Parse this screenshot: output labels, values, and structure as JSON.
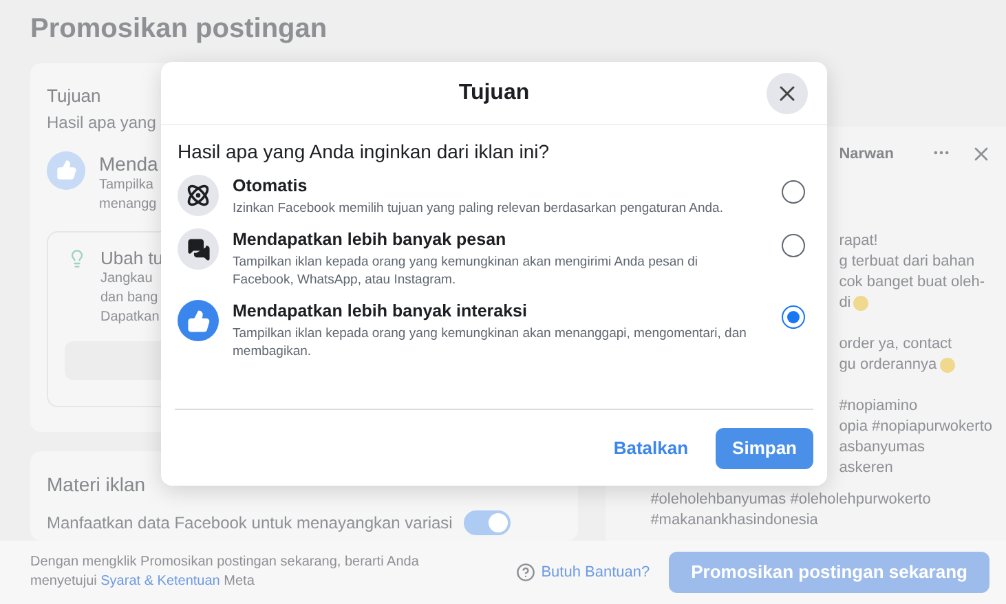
{
  "page": {
    "title": "Promosikan postingan"
  },
  "objective_card": {
    "title": "Tujuan",
    "subtitle": "Hasil apa yang",
    "selected_objective": {
      "title": "Menda",
      "lines": [
        "Tampilka",
        "menangg"
      ]
    },
    "tip": {
      "title": "Ubah tu",
      "lines": [
        "Jangkau",
        "dan bang",
        "Dapatkan"
      ]
    }
  },
  "creative_card": {
    "title": "Materi iklan",
    "description": "Manfaatkan data Facebook untuk menayangkan variasi",
    "toggle": {
      "on": true
    }
  },
  "preview": {
    "author": "Narwan",
    "paragraphs": [
      [
        {
          "text": "rapat!"
        },
        {
          "text": "g terbuat dari bahan"
        },
        {
          "text": "cok banget buat oleh-"
        },
        {
          "text": "di",
          "emoji": true
        }
      ],
      [
        {
          "text": "order ya, contact"
        },
        {
          "text": "gu orderannya",
          "emoji": true
        }
      ],
      [
        {
          "text": "#nopiamino"
        },
        {
          "text": "opia #nopiapurwokerto"
        },
        {
          "text": "asbanyumas"
        },
        {
          "text": "askeren"
        }
      ]
    ],
    "hashtag_lines": [
      "#oleholehbanyumas #oleholehpurwokerto",
      "#makanankhasindonesia"
    ]
  },
  "footer": {
    "consent_text": "Dengan mengklik Promosikan postingan sekarang, berarti Anda menyetujui",
    "terms_link": "Syarat & Ketentuan",
    "brand": "Meta",
    "help": "Butuh Bantuan?",
    "primary_button": "Promosikan postingan sekarang"
  },
  "dialog": {
    "title": "Tujuan",
    "question": "Hasil apa yang Anda inginkan dari iklan ini?",
    "options": [
      {
        "title": "Otomatis",
        "description": "Izinkan Facebook memilih tujuan yang paling relevan berdasarkan pengaturan Anda.",
        "selected": false
      },
      {
        "title": "Mendapatkan lebih banyak pesan",
        "description": "Tampilkan iklan kepada orang yang kemungkinan akan mengirimi Anda pesan di Facebook, WhatsApp, atau Instagram.",
        "selected": false
      },
      {
        "title": "Mendapatkan lebih banyak interaksi",
        "description": "Tampilkan iklan kepada orang yang kemungkinan akan menanggapi, mengomentari, dan membagikan.",
        "selected": true
      }
    ],
    "cancel": "Batalkan",
    "save": "Simpan"
  }
}
